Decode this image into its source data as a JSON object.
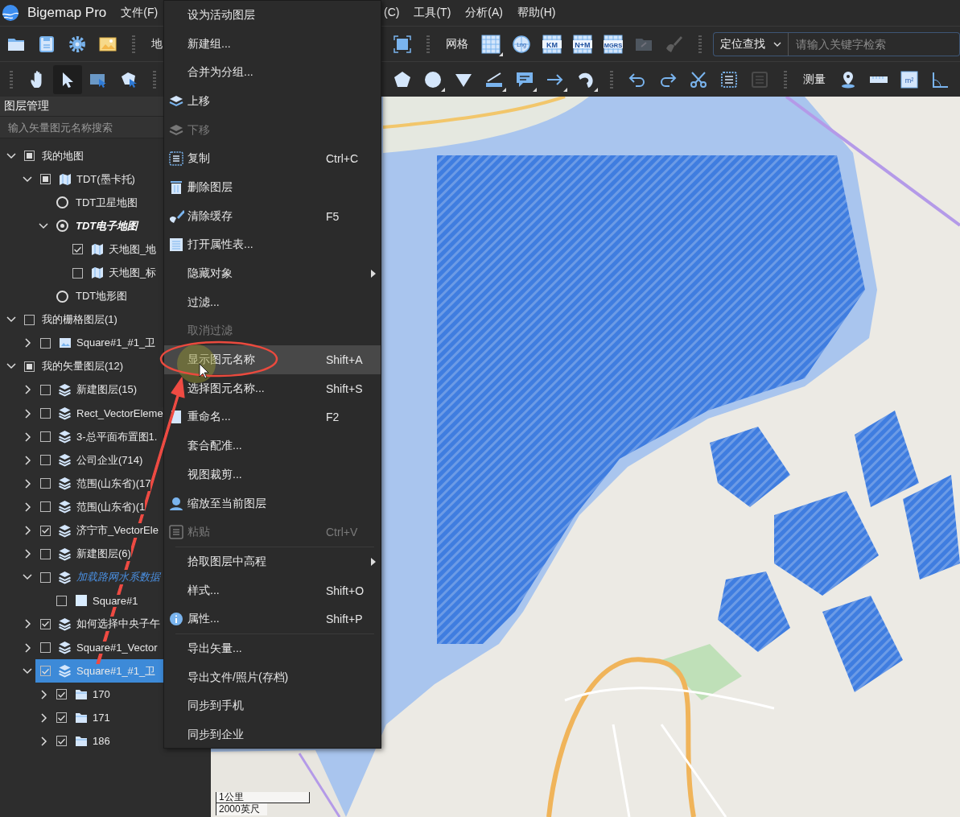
{
  "menubar": {
    "app_name": "Bigemap Pro",
    "menus": [
      "文件(F)"
    ],
    "menus_continued": [
      "(C)",
      "工具(T)",
      "分析(A)",
      "帮助(H)"
    ]
  },
  "toolbar_top": {
    "items": [
      {
        "kind": "folder",
        "selected": false,
        "disabled": false,
        "has_menu": false
      },
      {
        "kind": "save",
        "selected": false,
        "disabled": false,
        "has_menu": false
      },
      {
        "kind": "gear",
        "selected": false,
        "disabled": false,
        "has_menu": false
      },
      {
        "kind": "picture",
        "selected": false,
        "disabled": false,
        "has_menu": false
      },
      {
        "kind": "grip"
      },
      {
        "kind": "label",
        "text": "地"
      }
    ],
    "items_continued": [
      {
        "kind": "frame",
        "selected": false,
        "disabled": false,
        "has_menu": false
      },
      {
        "kind": "grip"
      },
      {
        "kind": "label",
        "text": "网格"
      },
      {
        "kind": "grid",
        "selected": false,
        "disabled": false,
        "has_menu": true
      },
      {
        "kind": "globe",
        "text": "Lng",
        "selected": false,
        "disabled": false,
        "has_menu": false
      },
      {
        "kind": "grid-tag",
        "text": "KM",
        "selected": false,
        "disabled": false,
        "has_menu": false
      },
      {
        "kind": "grid-tag",
        "text": "N+M",
        "selected": false,
        "disabled": false,
        "has_menu": false
      },
      {
        "kind": "grid-tag",
        "text": "MGRS",
        "selected": false,
        "disabled": false,
        "has_menu": false
      },
      {
        "kind": "folder-link",
        "selected": false,
        "disabled": true,
        "has_menu": false
      },
      {
        "kind": "brush",
        "selected": false,
        "disabled": true,
        "has_menu": false
      },
      {
        "kind": "grip"
      },
      {
        "kind": "search",
        "scope": "定位查找",
        "placeholder": "请输入关键字检索"
      }
    ]
  },
  "toolbar_bottom": {
    "items": [
      {
        "kind": "grip"
      },
      {
        "kind": "hand",
        "selected": false,
        "disabled": false,
        "has_menu": false
      },
      {
        "kind": "pointer",
        "selected": true,
        "disabled": false,
        "has_menu": false
      },
      {
        "kind": "rect-select",
        "selected": false,
        "disabled": false,
        "has_menu": false
      },
      {
        "kind": "poly-select",
        "selected": false,
        "disabled": false,
        "has_menu": false
      },
      {
        "kind": "grip"
      }
    ],
    "items_continued": [
      {
        "kind": "pentagon",
        "selected": false,
        "disabled": false,
        "has_menu": false
      },
      {
        "kind": "circle",
        "selected": false,
        "disabled": false,
        "has_menu": true
      },
      {
        "kind": "triangle",
        "selected": false,
        "disabled": false,
        "has_menu": false
      },
      {
        "kind": "line-tool",
        "selected": false,
        "disabled": false,
        "has_menu": true
      },
      {
        "kind": "comment",
        "selected": false,
        "disabled": false,
        "has_menu": true
      },
      {
        "kind": "arrow",
        "selected": false,
        "disabled": false,
        "has_menu": true
      },
      {
        "kind": "curve",
        "selected": false,
        "disabled": false,
        "has_menu": true
      },
      {
        "kind": "grip"
      },
      {
        "kind": "undo",
        "selected": false,
        "disabled": false,
        "has_menu": false
      },
      {
        "kind": "redo",
        "selected": false,
        "disabled": false,
        "has_menu": false
      },
      {
        "kind": "scissors",
        "selected": false,
        "disabled": false,
        "has_menu": false
      },
      {
        "kind": "copy-doc",
        "selected": false,
        "disabled": false,
        "has_menu": false
      },
      {
        "kind": "paste-doc",
        "selected": false,
        "disabled": true,
        "has_menu": false
      },
      {
        "kind": "grip"
      },
      {
        "kind": "label",
        "text": "测量"
      },
      {
        "kind": "pin",
        "selected": false,
        "disabled": false,
        "has_menu": false
      },
      {
        "kind": "ruler",
        "selected": false,
        "disabled": false,
        "has_menu": false
      },
      {
        "kind": "area",
        "text": "m²",
        "selected": false,
        "disabled": false,
        "has_menu": false
      },
      {
        "kind": "angle",
        "selected": false,
        "disabled": false,
        "has_menu": false
      }
    ]
  },
  "layer_panel": {
    "title": "图层管理",
    "search": {
      "placeholder": "输入矢量图元名称搜索"
    },
    "tree": [
      {
        "kind": "group",
        "label": "我的地图",
        "expanded": true,
        "checked": false,
        "partial": true,
        "selected": false,
        "children": [
          {
            "kind": "map-layer",
            "label": "TDT(墨卡托)",
            "expanded": true,
            "checked": false,
            "partial": true,
            "selected": false,
            "children": [
              {
                "kind": "radio",
                "label": "TDT卫星地图",
                "checked": false,
                "selected": false
              },
              {
                "kind": "radio",
                "label": "TDT电子地图",
                "expanded": true,
                "checked": true,
                "selected": false,
                "children": [
                  {
                    "kind": "map-layer",
                    "label": "天地图_地",
                    "checked": true,
                    "selected": false
                  },
                  {
                    "kind": "map-layer",
                    "label": "天地图_标",
                    "checked": false,
                    "selected": false
                  }
                ]
              },
              {
                "kind": "radio",
                "label": "TDT地形图",
                "checked": false,
                "selected": false
              }
            ]
          }
        ]
      },
      {
        "kind": "group",
        "label": "我的栅格图层(1)",
        "expanded": true,
        "checked": false,
        "selected": false,
        "children": [
          {
            "kind": "raster-layer",
            "label": "Square#1_#1_卫",
            "expanded": false,
            "checked": false,
            "selected": false
          }
        ]
      },
      {
        "kind": "group",
        "label": "我的矢量图层(12)",
        "expanded": true,
        "checked": false,
        "partial": true,
        "selected": false,
        "children": [
          {
            "kind": "vector-layer",
            "label": "新建图层(15)",
            "expanded": false,
            "checked": false,
            "selected": false
          },
          {
            "kind": "vector-layer",
            "label": "Rect_VectorEleme",
            "expanded": false,
            "checked": false,
            "selected": false
          },
          {
            "kind": "vector-layer",
            "label": "3-总平面布置图1.",
            "expanded": false,
            "checked": false,
            "selected": false
          },
          {
            "kind": "vector-layer",
            "label": "公司企业(714)",
            "expanded": false,
            "checked": false,
            "selected": false
          },
          {
            "kind": "vector-layer",
            "label": "范围(山东省)(17",
            "expanded": false,
            "checked": false,
            "selected": false
          },
          {
            "kind": "vector-layer",
            "label": "范围(山东省)(1",
            "expanded": false,
            "checked": false,
            "selected": false
          },
          {
            "kind": "vector-layer",
            "label": "济宁市_VectorEle",
            "expanded": false,
            "checked": true,
            "selected": false
          },
          {
            "kind": "vector-layer",
            "label": "新建图层(6)",
            "expanded": false,
            "checked": false,
            "selected": false
          },
          {
            "kind": "loading-layer",
            "label": "加载路网水系数据",
            "expanded": true,
            "checked": false,
            "selected": false,
            "children": [
              {
                "kind": "shape",
                "label": "Square#1",
                "checked": false,
                "selected": false
              }
            ]
          },
          {
            "kind": "vector-layer",
            "label": "如何选择中央子午",
            "expanded": false,
            "checked": true,
            "selected": false
          },
          {
            "kind": "vector-layer",
            "label": "Square#1_Vector",
            "expanded": false,
            "checked": false,
            "selected": false
          },
          {
            "kind": "vector-layer",
            "label": "Square#1_#1_卫",
            "expanded": true,
            "checked": true,
            "selected": true,
            "children": [
              {
                "kind": "folder",
                "label": "170",
                "expanded": false,
                "checked": true,
                "selected": false
              },
              {
                "kind": "folder",
                "label": "171",
                "expanded": false,
                "checked": true,
                "selected": false
              },
              {
                "kind": "folder",
                "label": "186",
                "expanded": false,
                "checked": true,
                "selected": false
              }
            ]
          }
        ]
      }
    ]
  },
  "map": {
    "scale_bar": {
      "metric": "1公里",
      "imperial": "2000英尺"
    }
  },
  "context_menu": {
    "sections": [
      [
        {
          "kind": "plain",
          "label": "设为活动图层",
          "disabled": false,
          "selected": false,
          "submenu": false
        },
        {
          "kind": "plain",
          "label": "新建组...",
          "disabled": false,
          "selected": false,
          "submenu": false
        },
        {
          "kind": "plain",
          "label": "合并为分组...",
          "disabled": false,
          "selected": false,
          "submenu": false
        },
        {
          "kind": "layers-up",
          "label": "上移",
          "disabled": false,
          "selected": false,
          "submenu": false
        },
        {
          "kind": "layers-down",
          "label": "下移",
          "disabled": true,
          "selected": false,
          "submenu": false
        },
        {
          "kind": "copy",
          "label": "复制",
          "shortcut": "Ctrl+C",
          "disabled": false,
          "selected": false,
          "submenu": false
        },
        {
          "kind": "trash",
          "label": "删除图层",
          "disabled": false,
          "selected": false,
          "submenu": false
        },
        {
          "kind": "brush",
          "label": "清除缓存",
          "shortcut": "F5",
          "disabled": false,
          "selected": false,
          "submenu": false
        },
        {
          "kind": "table",
          "label": "打开属性表...",
          "disabled": false,
          "selected": false,
          "submenu": false
        },
        {
          "kind": "plain",
          "label": "隐藏对象",
          "disabled": false,
          "selected": false,
          "submenu": true
        },
        {
          "kind": "plain",
          "label": "过滤...",
          "disabled": false,
          "selected": false,
          "submenu": false
        },
        {
          "kind": "plain",
          "label": "取消过滤",
          "disabled": true,
          "selected": false,
          "submenu": false
        },
        {
          "kind": "plain",
          "label": "显示图元名称",
          "shortcut": "Shift+A",
          "disabled": false,
          "selected": true,
          "submenu": false
        },
        {
          "kind": "plain",
          "label": "选择图元名称...",
          "shortcut": "Shift+S",
          "disabled": false,
          "selected": false,
          "submenu": false
        },
        {
          "kind": "page",
          "label": "重命名...",
          "shortcut": "F2",
          "disabled": false,
          "selected": false,
          "submenu": false
        },
        {
          "kind": "plain",
          "label": "套合配准...",
          "disabled": false,
          "selected": false,
          "submenu": false
        },
        {
          "kind": "plain",
          "label": "视图裁剪...",
          "disabled": false,
          "selected": false,
          "submenu": false
        },
        {
          "kind": "person",
          "label": "缩放至当前图层",
          "disabled": false,
          "selected": false,
          "submenu": false
        },
        {
          "kind": "paste",
          "label": "粘贴",
          "shortcut": "Ctrl+V",
          "disabled": true,
          "selected": false,
          "submenu": false
        }
      ],
      [
        {
          "kind": "plain",
          "label": "拾取图层中高程",
          "disabled": false,
          "selected": false,
          "submenu": true
        },
        {
          "kind": "plain",
          "label": "样式...",
          "shortcut": "Shift+O",
          "disabled": false,
          "selected": false,
          "submenu": false
        },
        {
          "kind": "info",
          "label": "属性...",
          "shortcut": "Shift+P",
          "disabled": false,
          "selected": false,
          "submenu": false
        }
      ],
      [
        {
          "kind": "plain",
          "label": "导出矢量...",
          "disabled": false,
          "selected": false,
          "submenu": false
        },
        {
          "kind": "plain",
          "label": "导出文件/照片(存档)",
          "disabled": false,
          "selected": false,
          "submenu": false
        },
        {
          "kind": "plain",
          "label": "同步到手机",
          "disabled": false,
          "selected": false,
          "submenu": false
        },
        {
          "kind": "plain",
          "label": "同步到企业",
          "disabled": false,
          "selected": false,
          "submenu": false
        }
      ]
    ]
  }
}
